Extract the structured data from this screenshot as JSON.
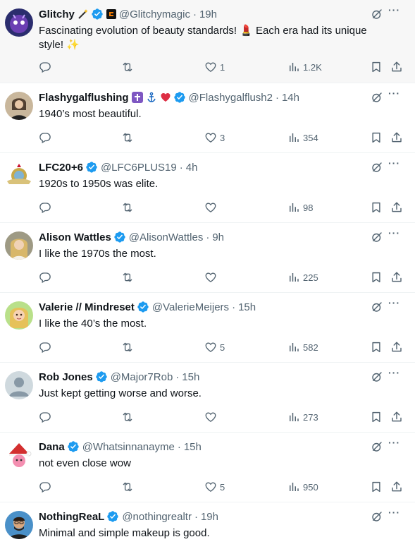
{
  "tweets": [
    {
      "name": "Glitchy",
      "handle": "@Glitchymagic",
      "time": "19h",
      "text": "Fascinating evolution of beauty standards! 💄 Each era had its unique style! ✨",
      "likes": "1",
      "views": "1.2K"
    },
    {
      "name": "Flashygalflushing",
      "handle": "@Flashygalflush2",
      "time": "14h",
      "text": "1940’s most beautiful.",
      "likes": "3",
      "views": "354"
    },
    {
      "name": "LFC20+6",
      "handle": "@LFC6PLUS19",
      "time": "4h",
      "text": "1920s to 1950s was elite.",
      "likes": "",
      "views": "98"
    },
    {
      "name": "Alison Wattles",
      "handle": "@AlisonWattles",
      "time": "9h",
      "text": "I like the 1970s the most.",
      "likes": "",
      "views": "225"
    },
    {
      "name": "Valerie // Mindreset",
      "handle": "@ValerieMeijers",
      "time": "15h",
      "text": "I like the 40’s the most.",
      "likes": "5",
      "views": "582"
    },
    {
      "name": "Rob Jones",
      "handle": "@Major7Rob",
      "time": "15h",
      "text": "Just kept getting worse and worse.",
      "likes": "",
      "views": "273"
    },
    {
      "name": "Dana",
      "handle": "@Whatsinnanayme",
      "time": "15h",
      "text": "not even close wow",
      "likes": "5",
      "views": "950"
    },
    {
      "name": "NothingReaL",
      "handle": "@nothingrealtr",
      "time": "19h",
      "text": "Minimal and simple makeup is good.",
      "likes": "",
      "views": ""
    }
  ],
  "colors": {
    "verified": "#1d9bf0",
    "icon": "#536471",
    "text": "#0f1419",
    "highlight_bg": "#f7f7f7"
  },
  "icons": [
    "reply-icon",
    "repost-icon",
    "like-icon",
    "views-icon",
    "bookmark-icon",
    "share-icon",
    "grok-icon",
    "more-icon",
    "verified-badge-icon"
  ]
}
